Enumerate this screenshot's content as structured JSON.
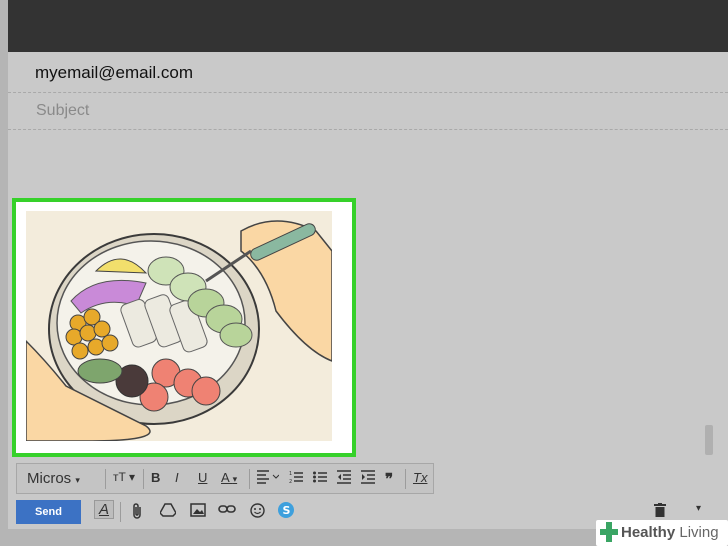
{
  "compose": {
    "to": "myemail@email.com",
    "subject_placeholder": "Subject"
  },
  "format_toolbar": {
    "font": "Micros",
    "font_size_icon": "font-size-icon",
    "bold": "B",
    "italic": "I",
    "underline": "U",
    "text_color": "A",
    "quote": "❞",
    "remove_formatting": "Tx"
  },
  "bottom_toolbar": {
    "send_label": "Send",
    "formatting_toggle": "A"
  },
  "watermark": {
    "brand_bold": "Healthy",
    "brand_light": "Living"
  },
  "colors": {
    "highlight": "#36d12a",
    "send": "#3c72c4",
    "titlebar": "#333333"
  }
}
